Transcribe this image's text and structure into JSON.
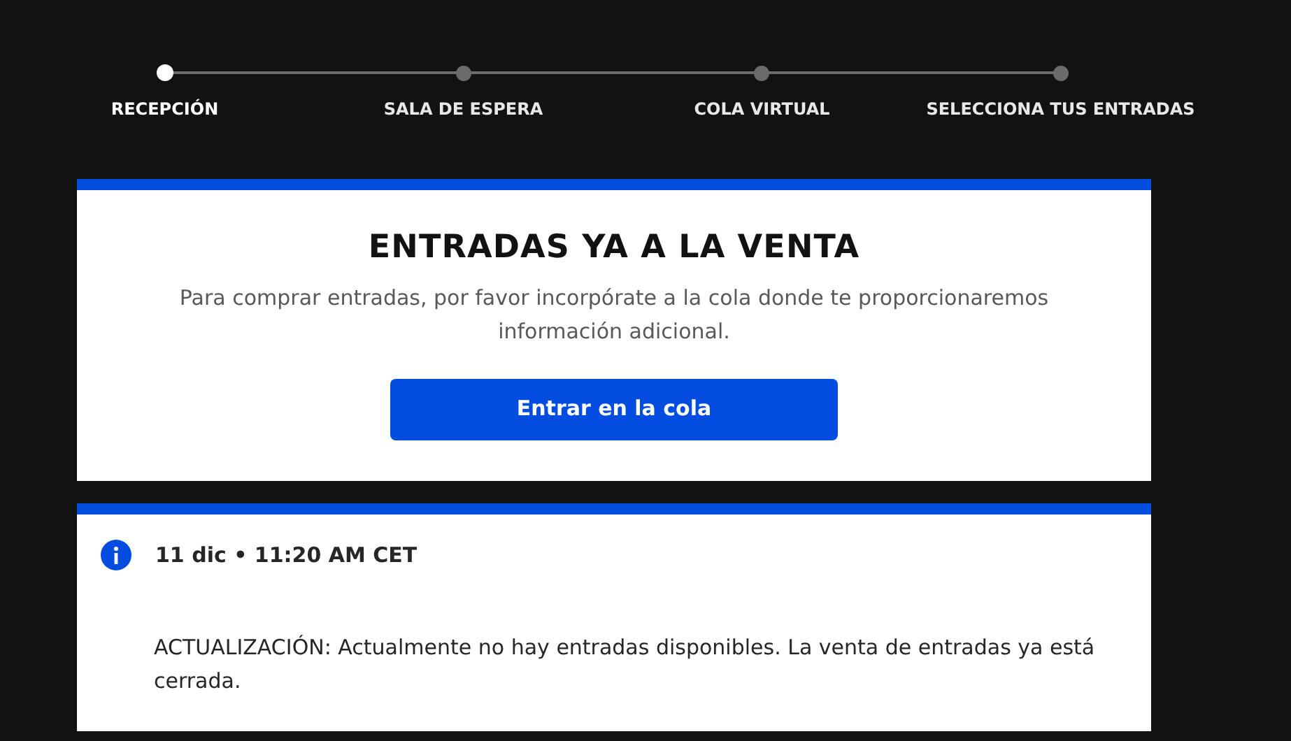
{
  "steps": [
    {
      "label": "RECEPCIÓN",
      "selected": true
    },
    {
      "label": "SALA DE ESPERA",
      "selected": false
    },
    {
      "label": "COLA VIRTUAL",
      "selected": false
    },
    {
      "label": "SELECCIONA TUS ENTRADAS",
      "selected": false
    }
  ],
  "sale_card": {
    "title": "ENTRADAS YA A LA VENTA",
    "description": "Para comprar entradas, por favor incorpórate a la cola donde te proporcionaremos información adicional.",
    "button": "Entrar en la cola"
  },
  "update_card": {
    "timestamp": "11 dic • 11:20 AM CET",
    "message": "ACTUALIZACIÓN: Actualmente no hay entradas disponibles. La venta de entradas ya está cerrada."
  }
}
